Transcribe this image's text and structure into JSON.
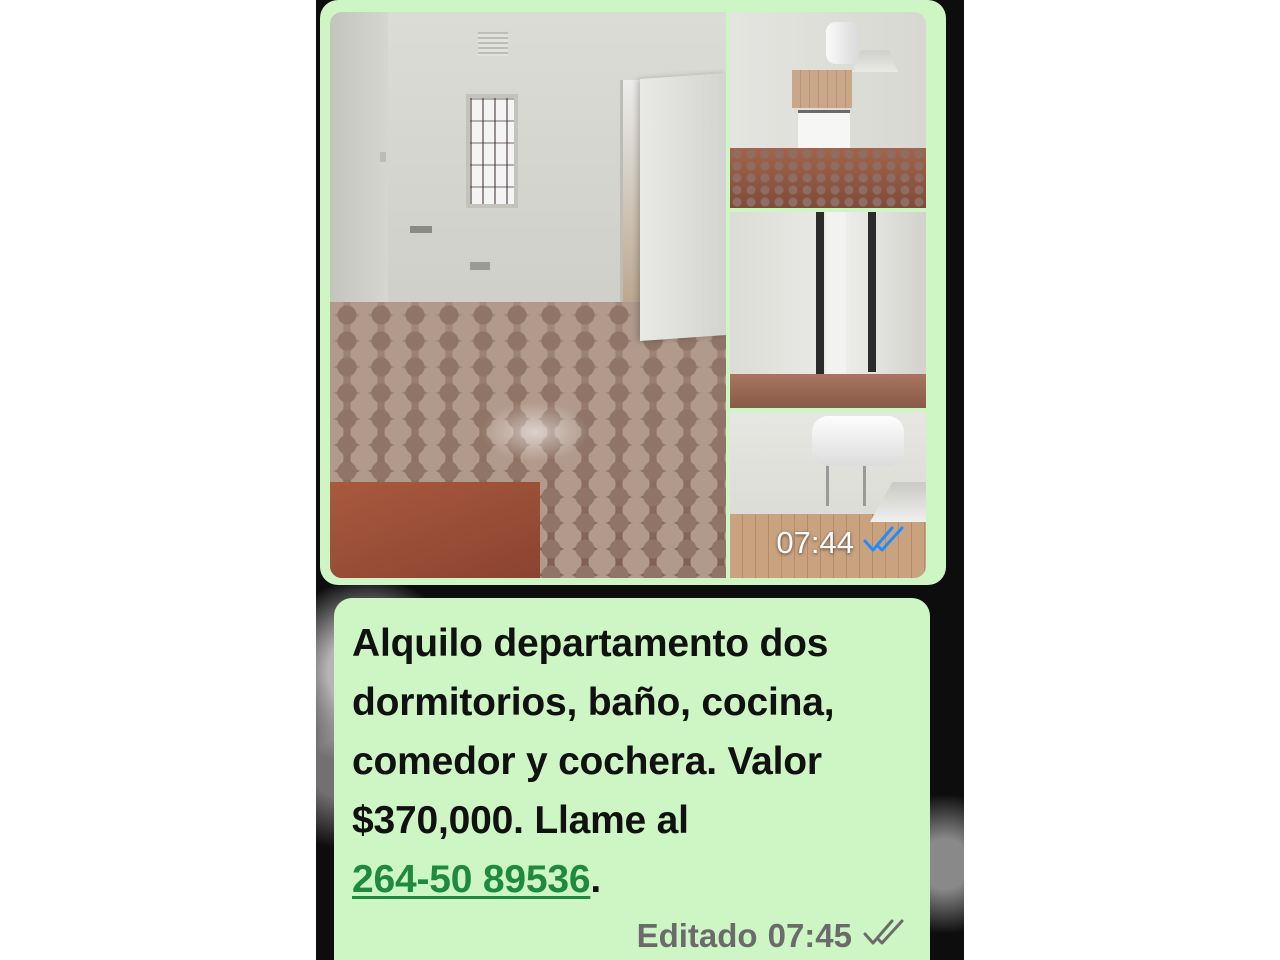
{
  "image_message": {
    "time": "07:44",
    "status_icon": "double-check-read-icon",
    "photos": [
      "room-photo",
      "kitchen-photo",
      "hallway-photo",
      "water-heater-photo"
    ]
  },
  "text_message": {
    "line1": "Alquilo departamento dos",
    "line2": "dormitorios, baño, cocina,",
    "line3": "comedor y cochera. Valor",
    "line4": "$370,000. Llame al",
    "phone": "264-50 89536",
    "trailing": ".",
    "edited_label": "Editado",
    "time": "07:45",
    "status_icon": "double-check-icon"
  },
  "colors": {
    "bubble": "#cdf6c4",
    "link": "#1e8a3e",
    "read_ticks": "#1f8cff",
    "meta_text": "#6b6b6b"
  }
}
